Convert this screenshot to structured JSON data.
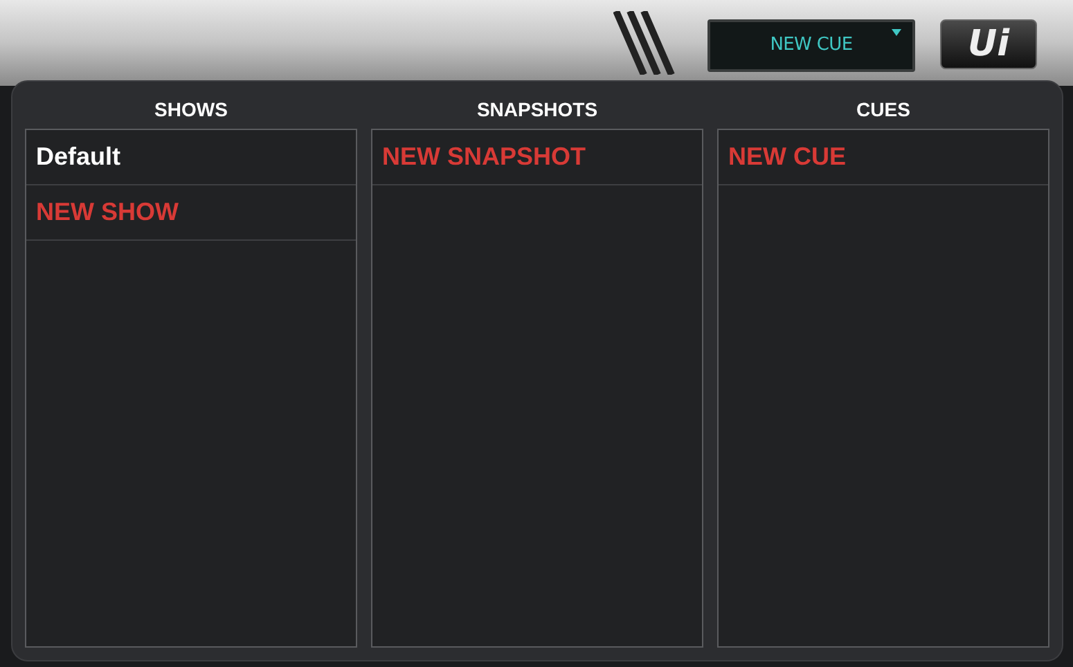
{
  "header": {
    "display": {
      "value": "NEW CUE"
    },
    "logo": "Ui"
  },
  "columns": [
    {
      "title": "SHOWS",
      "items": [
        {
          "label": "Default",
          "kind": "item"
        },
        {
          "label": "NEW SHOW",
          "kind": "new"
        }
      ]
    },
    {
      "title": "SNAPSHOTS",
      "items": [
        {
          "label": "NEW SNAPSHOT",
          "kind": "new"
        }
      ]
    },
    {
      "title": "CUES",
      "items": [
        {
          "label": "NEW CUE",
          "kind": "new"
        }
      ]
    }
  ]
}
